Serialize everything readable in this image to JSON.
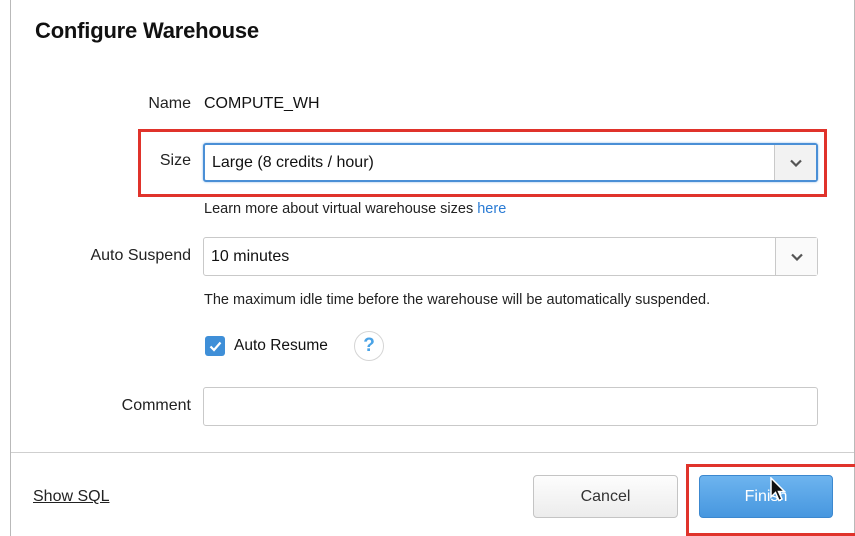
{
  "dialog": {
    "title": "Configure Warehouse"
  },
  "form": {
    "name": {
      "label": "Name",
      "value": "COMPUTE_WH"
    },
    "size": {
      "label": "Size",
      "value": "Large  (8 credits / hour)",
      "help_prefix": "Learn more about virtual warehouse sizes ",
      "help_link": "here"
    },
    "auto_suspend": {
      "label": "Auto Suspend",
      "value": "10 minutes",
      "help": "The maximum idle time before the warehouse will be automatically suspended."
    },
    "auto_resume": {
      "label": "Auto Resume",
      "checked": true,
      "help_icon": "?"
    },
    "comment": {
      "label": "Comment",
      "value": ""
    }
  },
  "footer": {
    "show_sql": "Show SQL",
    "cancel": "Cancel",
    "finish": "Finish"
  },
  "colors": {
    "accent": "#4a8fd6",
    "highlight": "#e0332b",
    "finish_button": "#4797df"
  },
  "icons": {
    "dropdown": "chevron-down-icon",
    "checkbox": "checkmark-icon",
    "help": "question-mark-icon",
    "cursor": "mouse-pointer-icon"
  }
}
